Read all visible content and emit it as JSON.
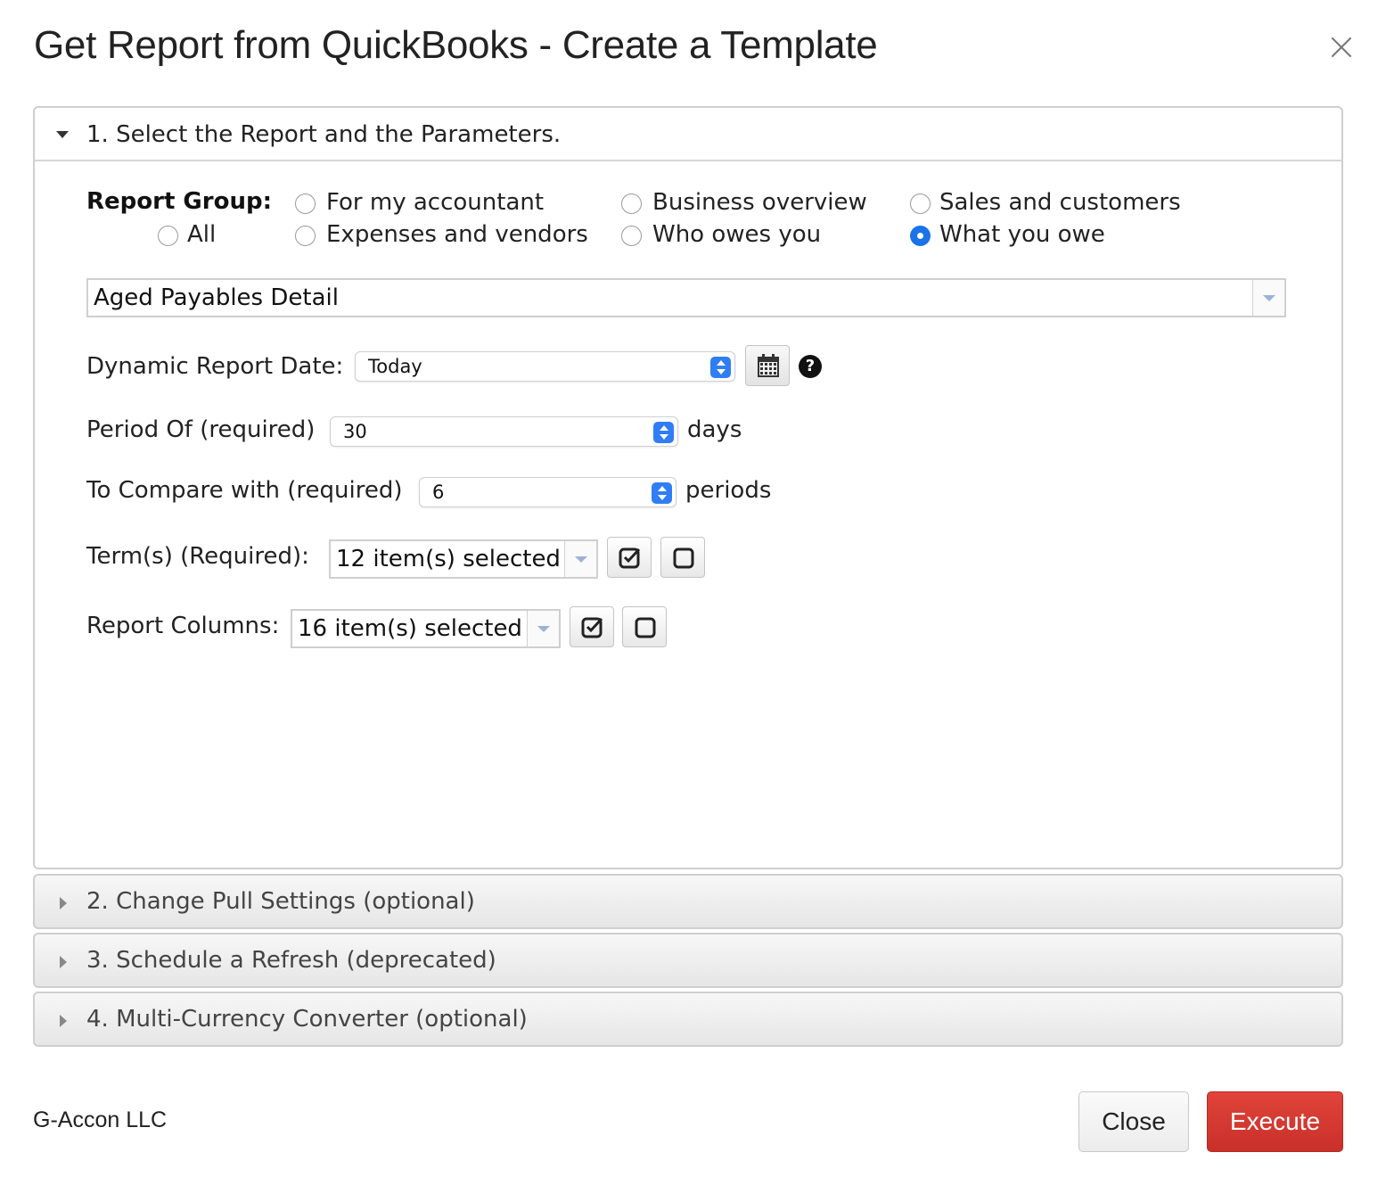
{
  "dialog": {
    "title": "Get Report from QuickBooks - Create a Template",
    "close_icon": "close-icon"
  },
  "sections": [
    {
      "label": "1. Select the Report and the Parameters.",
      "expanded": true
    },
    {
      "label": "2. Change Pull Settings (optional)",
      "expanded": false
    },
    {
      "label": "3. Schedule a Refresh (deprecated)",
      "expanded": false
    },
    {
      "label": "4. Multi-Currency Converter (optional)",
      "expanded": false
    }
  ],
  "report_group": {
    "label": "Report Group:",
    "options": [
      {
        "label": "For my accountant",
        "selected": false
      },
      {
        "label": "Business overview",
        "selected": false
      },
      {
        "label": "Sales and customers",
        "selected": false
      },
      {
        "label": "All",
        "selected": false
      },
      {
        "label": "Expenses and vendors",
        "selected": false
      },
      {
        "label": "Who owes you",
        "selected": false
      },
      {
        "label": "What you owe",
        "selected": true
      }
    ],
    "selected_color": "#1a73e8"
  },
  "report_select": {
    "value": "Aged Payables Detail"
  },
  "dynamic_date": {
    "label": "Dynamic Report Date:",
    "value": "Today",
    "calendar_icon": "calendar-icon",
    "help_icon": "help-icon",
    "help_glyph": "?"
  },
  "period_of": {
    "label": "Period Of (required)",
    "value": "30",
    "suffix": "days"
  },
  "compare_with": {
    "label": "To Compare with (required)",
    "value": "6",
    "suffix": "periods"
  },
  "terms": {
    "label": "Term(s) (Required):",
    "value": "12 item(s) selected"
  },
  "report_columns": {
    "label": "Report Columns:",
    "value": "16 item(s) selected"
  },
  "footer": {
    "brand": "G-Accon LLC",
    "close_label": "Close",
    "execute_label": "Execute",
    "execute_color": "#d33b32"
  }
}
